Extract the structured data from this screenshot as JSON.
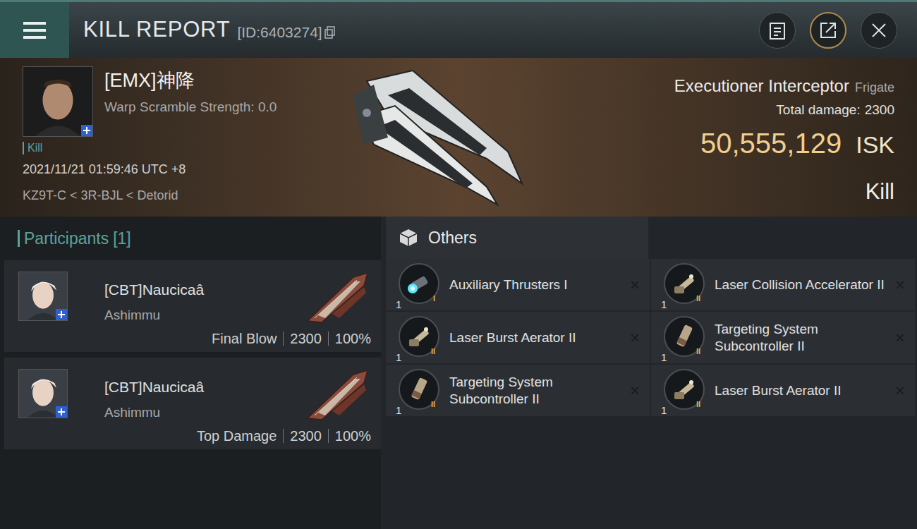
{
  "header": {
    "title": "KILL REPORT",
    "id": "[ID:6403274]"
  },
  "victim": {
    "name": "[EMX]神降",
    "warp_scramble": "Warp Scramble Strength: 0.0",
    "tag": "Kill",
    "time": "2021/11/21 01:59:46 UTC +8",
    "location": "KZ9T-C < 3R-BJL < Detorid"
  },
  "ship": {
    "name": "Executioner Interceptor",
    "class": "Frigate",
    "damage_label": "Total damage:",
    "damage": "2300",
    "value": "50,555,129",
    "currency": "ISK",
    "result": "Kill"
  },
  "participants": {
    "title": "Participants",
    "count": "[1]",
    "items": [
      {
        "name": "[CBT]Naucicaâ",
        "ship": "Ashimmu",
        "role": "Final Blow",
        "damage": "2300",
        "share": "100%"
      },
      {
        "name": "[CBT]Naucicaâ",
        "ship": "Ashimmu",
        "role": "Top Damage",
        "damage": "2300",
        "share": "100%"
      }
    ]
  },
  "others": {
    "title": "Others",
    "remove": "×",
    "items": [
      {
        "name": "Auxiliary Thrusters I",
        "quantity": "1",
        "tier": "I",
        "kind": "thruster"
      },
      {
        "name": "Laser Collision Accelerator II",
        "quantity": "1",
        "tier": "II",
        "kind": "laser"
      },
      {
        "name": "Laser Burst Aerator II",
        "quantity": "1",
        "tier": "II",
        "kind": "laser"
      },
      {
        "name": "Targeting System Subcontroller II",
        "quantity": "1",
        "tier": "II",
        "kind": "targeting"
      },
      {
        "name": "Targeting System Subcontroller II",
        "quantity": "1",
        "tier": "II",
        "kind": "targeting"
      },
      {
        "name": "Laser Burst Aerator II",
        "quantity": "1",
        "tier": "II",
        "kind": "laser"
      }
    ]
  }
}
